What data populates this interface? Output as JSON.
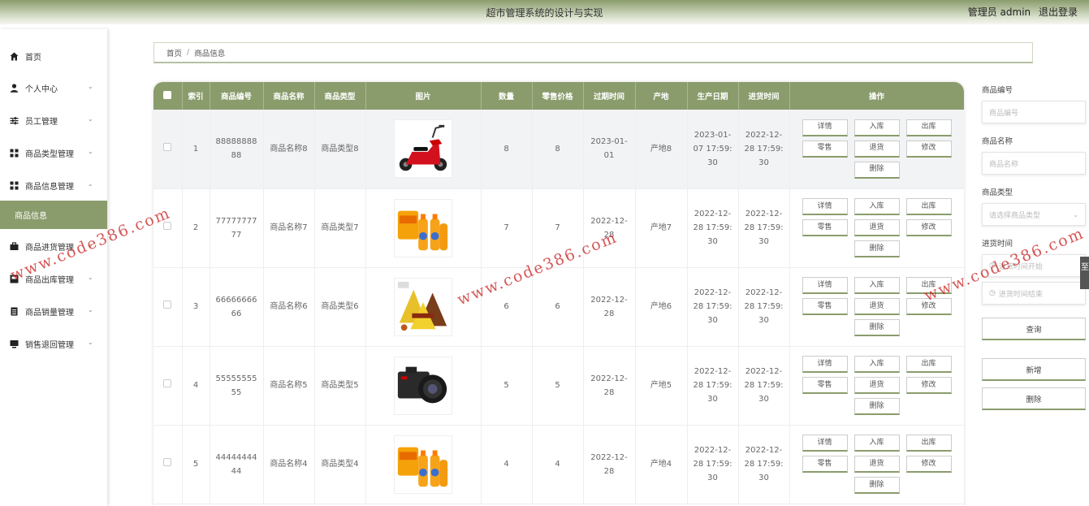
{
  "header": {
    "title": "超市管理系统的设计与实现",
    "user_label": "管理员 admin",
    "logout": "退出登录"
  },
  "sidebar": {
    "items": [
      {
        "label": "首页",
        "icon": "home-icon",
        "chevron": false
      },
      {
        "label": "个人中心",
        "icon": "user-icon",
        "chevron": true
      },
      {
        "label": "员工管理",
        "icon": "sliders-icon",
        "chevron": true
      },
      {
        "label": "商品类型管理",
        "icon": "grid-icon",
        "chevron": true
      },
      {
        "label": "商品信息管理",
        "icon": "grid-icon",
        "chevron": true
      },
      {
        "label": "商品信息",
        "icon": "",
        "chevron": false
      },
      {
        "label": "商品进货管理",
        "icon": "briefcase-icon",
        "chevron": true
      },
      {
        "label": "商品出库管理",
        "icon": "box-icon",
        "chevron": true
      },
      {
        "label": "商品销量管理",
        "icon": "document-icon",
        "chevron": true
      },
      {
        "label": "销售退回管理",
        "icon": "monitor-icon",
        "chevron": true
      }
    ]
  },
  "breadcrumb": {
    "home": "首页",
    "sep": "/",
    "current": "商品信息"
  },
  "table": {
    "headers": [
      "索引",
      "商品编号",
      "商品名称",
      "商品类型",
      "图片",
      "数量",
      "零售价格",
      "过期时间",
      "产地",
      "生产日期",
      "进货时间",
      "操作"
    ],
    "rows": [
      {
        "index": "1",
        "code": "8888888888",
        "name": "商品名称8",
        "type": "商品类型8",
        "image": "scooter",
        "qty": "8",
        "price": "8",
        "expire": "2023-01-01",
        "origin": "产地8",
        "produced": "2023-01-07 17:59:30",
        "stocked": "2022-12-28 17:59:30"
      },
      {
        "index": "2",
        "code": "7777777777",
        "name": "商品名称7",
        "type": "商品类型7",
        "image": "drinks",
        "qty": "7",
        "price": "7",
        "expire": "2022-12-28",
        "origin": "产地7",
        "produced": "2022-12-28 17:59:30",
        "stocked": "2022-12-28 17:59:30"
      },
      {
        "index": "3",
        "code": "6666666666",
        "name": "商品名称6",
        "type": "商品类型6",
        "image": "chocolate",
        "qty": "6",
        "price": "6",
        "expire": "2022-12-28",
        "origin": "产地6",
        "produced": "2022-12-28 17:59:30",
        "stocked": "2022-12-28 17:59:30"
      },
      {
        "index": "4",
        "code": "5555555555",
        "name": "商品名称5",
        "type": "商品类型5",
        "image": "camera",
        "qty": "5",
        "price": "5",
        "expire": "2022-12-28",
        "origin": "产地5",
        "produced": "2022-12-28 17:59:30",
        "stocked": "2022-12-28 17:59:30"
      },
      {
        "index": "5",
        "code": "4444444444",
        "name": "商品名称4",
        "type": "商品类型4",
        "image": "drinks",
        "qty": "4",
        "price": "4",
        "expire": "2022-12-28",
        "origin": "产地4",
        "produced": "2022-12-28 17:59:30",
        "stocked": "2022-12-28 17:59:30"
      }
    ],
    "actions": {
      "detail": "详情",
      "stock_in": "入库",
      "stock_out": "出库",
      "retail": "零售",
      "return": "退货",
      "edit": "修改",
      "delete": "删除"
    }
  },
  "search": {
    "code_label": "商品编号",
    "code_placeholder": "商品编号",
    "name_label": "商品名称",
    "name_placeholder": "商品名称",
    "type_label": "商品类型",
    "type_placeholder": "请选择商品类型",
    "time_label": "进货时间",
    "time_start": "进货时间开始",
    "time_end": "进货时间结束",
    "query": "查询",
    "add": "新增",
    "delete": "删除"
  },
  "side_tab": "至",
  "watermark": "www.code386.com",
  "colors": {
    "accent": "#8a9c6c",
    "watermark": "#c81e1e"
  }
}
